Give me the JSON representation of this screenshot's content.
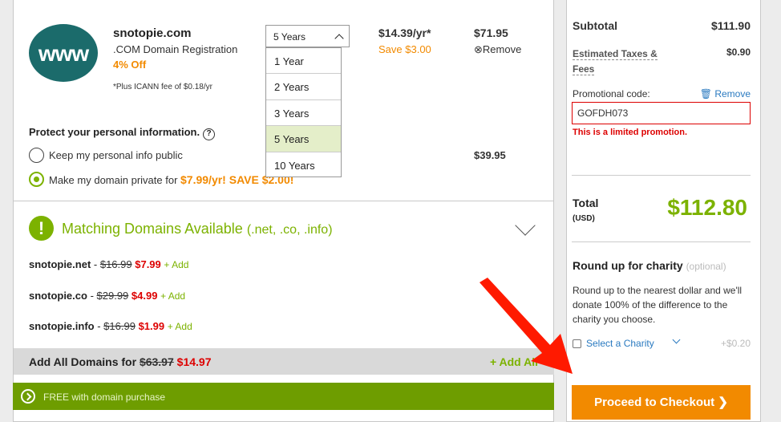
{
  "cart_item": {
    "logo_text": "www",
    "domain": "snotopie.com",
    "product": ".COM Domain Registration",
    "discount": "4% Off",
    "icann_note": "*Plus ICANN fee of $0.18/yr",
    "term_selected": "5 Years",
    "term_options": [
      "1 Year",
      "2 Years",
      "3 Years",
      "5 Years",
      "10 Years"
    ],
    "price_per_year": "$14.39/yr*",
    "savings": "Save $3.00",
    "line_total": "$71.95",
    "remove_label": "Remove"
  },
  "privacy": {
    "heading": "Protect your personal information.",
    "help_icon": "?",
    "option_public": "Keep my personal info public",
    "option_public_price": "$39.95",
    "option_private_prefix": "Make my domain private for ",
    "option_private_offer": "$7.99/yr! SAVE $2.00!"
  },
  "matching": {
    "title": "Matching Domains Available",
    "title_suffix": "(.net, .co, .info)",
    "domains": [
      {
        "name": "snotopie.net",
        "old": "$16.99",
        "new": "$7.99",
        "add": "+ Add"
      },
      {
        "name": "snotopie.co",
        "old": "$29.99",
        "new": "$4.99",
        "add": "+ Add"
      },
      {
        "name": "snotopie.info",
        "old": "$16.99",
        "new": "$1.99",
        "add": "+ Add"
      }
    ],
    "add_all_prefix": "Add All Domains for ",
    "add_all_old": "$63.97",
    "add_all_new": "$14.97",
    "add_all_label": "+ Add All"
  },
  "free_banner": "FREE with domain purchase",
  "summary": {
    "subtotal_label": "Subtotal",
    "subtotal_value": "$111.90",
    "tax_label": "Estimated Taxes & Fees",
    "tax_value": "$0.90",
    "promo_label": "Promotional code:",
    "promo_remove": "Remove",
    "promo_code": "GOFDH073",
    "promo_message": "This is a limited promotion.",
    "total_label": "Total",
    "total_currency": "(USD)",
    "total_value": "$112.80",
    "charity_title": "Round up for charity",
    "charity_optional": "(optional)",
    "charity_desc": "Round up to the nearest dollar and we'll donate 100% of the difference to the charity you choose.",
    "charity_select": "Select a Charity",
    "charity_amount": "+$0.20",
    "checkout_label": "Proceed to Checkout"
  },
  "colors": {
    "accent_green": "#7cb200",
    "accent_orange": "#f28a00",
    "error_red": "#d00000",
    "link_blue": "#2a7ac0",
    "annotation_arrow": "#ff1a00"
  }
}
